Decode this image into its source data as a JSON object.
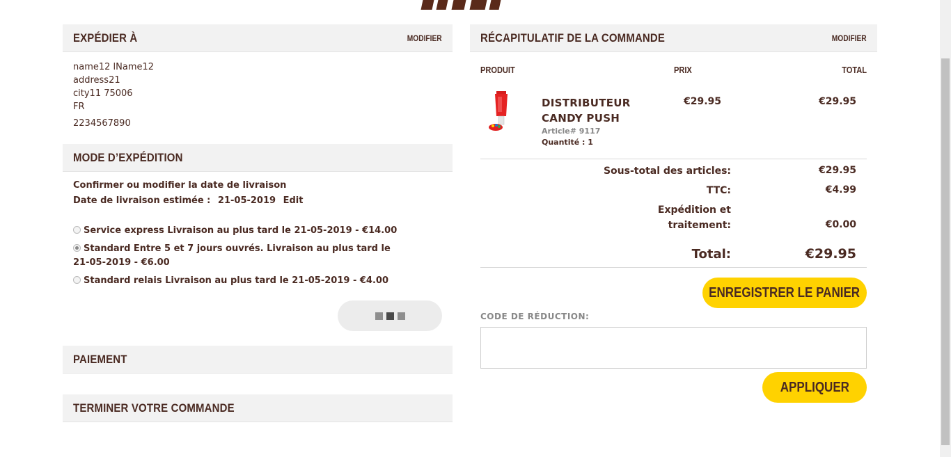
{
  "shipping": {
    "title": "EXPÉDIER À",
    "modify": "MODIFIER",
    "name": "name12 lName12",
    "address": "address21",
    "city": "city11 75006",
    "country": "FR",
    "phone": "2234567890"
  },
  "shipping_method": {
    "title": "MODE D’EXPÉDITION",
    "confirm_text": "Confirmer ou modifier la date de livraison",
    "date_label": "Date de livraison estimée :",
    "date_value": "21-05-2019",
    "edit": "Edit",
    "options": [
      {
        "label": "Service express Livraison au plus tard le 21-05-2019 - €14.00",
        "selected": false
      },
      {
        "label": "Standard Entre 5 et 7 jours ouvrés. Livraison au plus tard le 21-05-2019 - €6.00",
        "selected": true
      },
      {
        "label": "Standard relais Livraison au plus tard le 21-05-2019 - €4.00",
        "selected": false
      }
    ]
  },
  "payment": {
    "title": "PAIEMENT"
  },
  "finish": {
    "title": "TERMINER VOTRE COMMANDE"
  },
  "summary": {
    "title": "RÉCAPITULATIF DE LA COMMANDE",
    "modify": "MODIFIER",
    "col_product": "PRODUIT",
    "col_price": "PRIX",
    "col_total": "TOTAL",
    "item": {
      "name": "DISTRIBUTEUR CANDY PUSH",
      "sku": "Article# 9117",
      "qty": "Quantité : 1",
      "price": "€29.95",
      "total": "€29.95"
    },
    "subtotal_label": "Sous-total des articles:",
    "subtotal_value": "€29.95",
    "tax_label": "TTC:",
    "tax_value": "€4.99",
    "shipping_label_1": "Expédition et",
    "shipping_label_2": "traitement:",
    "shipping_value": "€0.00",
    "total_label": "Total:",
    "total_value": "€29.95",
    "save_cart": "ENREGISTRER LE PANIER",
    "code_label": "CODE DE RÉDUCTION:",
    "code_value": "",
    "apply": "APPLIQUER"
  },
  "colors": {
    "accent": "#ffd200",
    "text": "#4a2a22",
    "panel": "#f2f2f2"
  }
}
